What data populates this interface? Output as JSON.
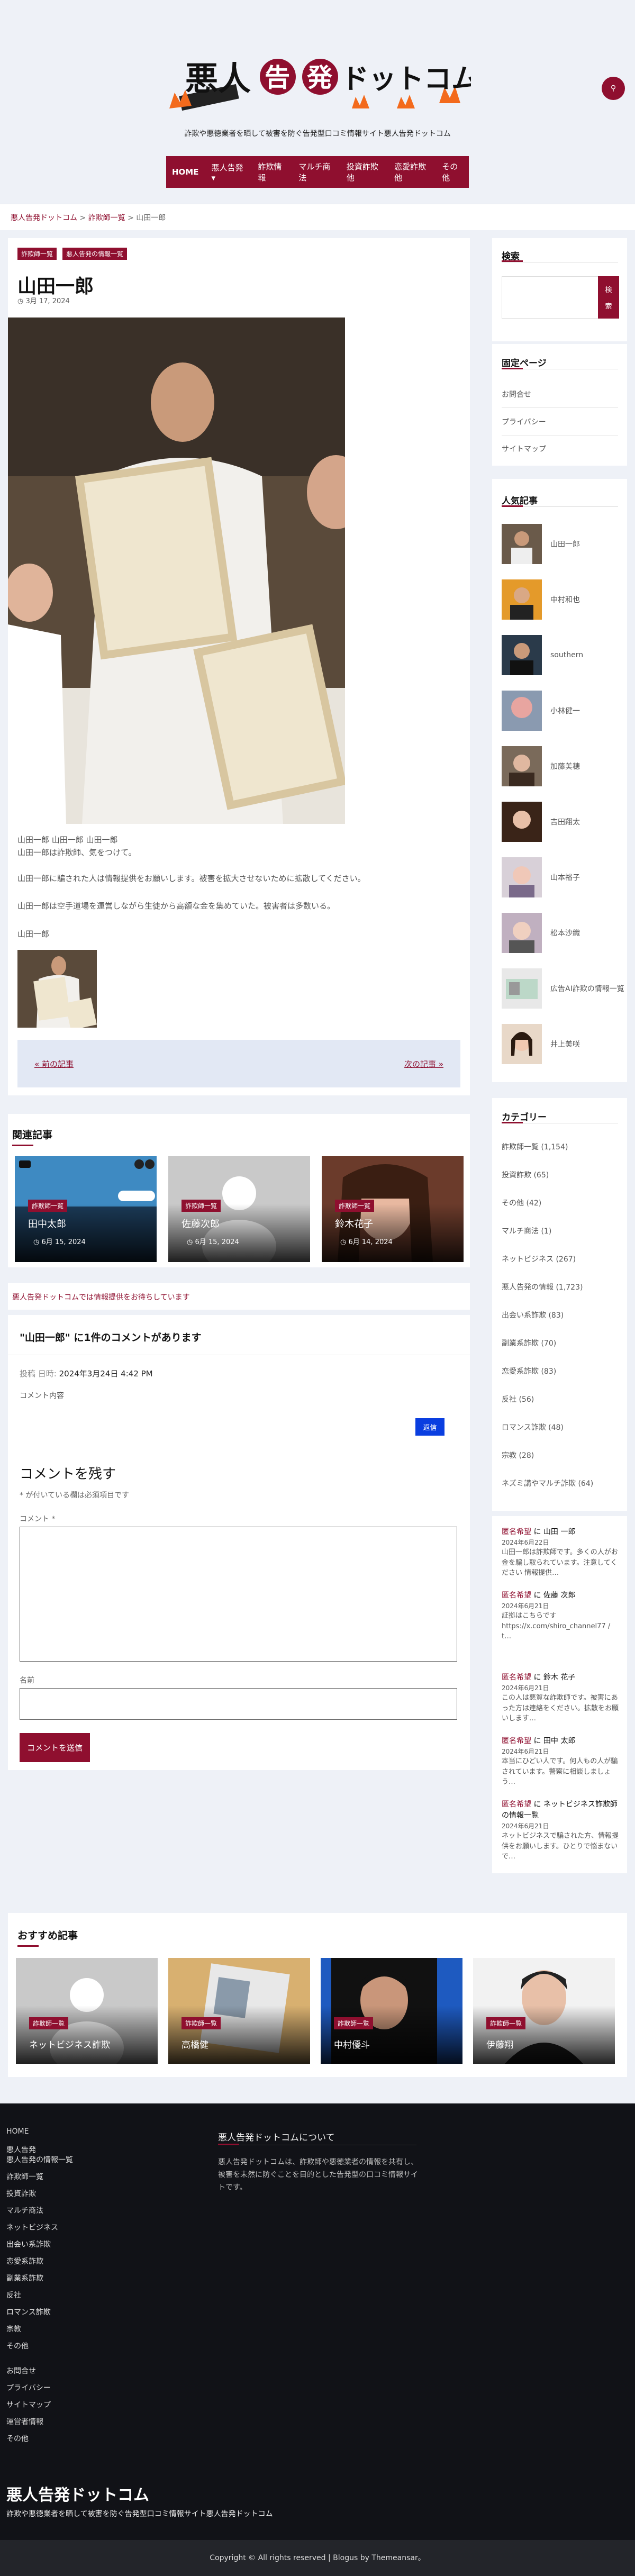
{
  "header": {
    "logo_text": "悪人告発ドットコム",
    "tagline": "詐欺や悪徳業者を晒して被害を防ぐ告発型口コミ情報サイト悪人告発ドットコム",
    "search_icon": "search-icon"
  },
  "nav": {
    "items": [
      "HOME",
      "悪人告発 ▾",
      "詐欺情報",
      "マルチ商法",
      "投資詐欺他",
      "恋愛詐欺他",
      "その他"
    ]
  },
  "breadcrumb": {
    "home": "悪人告発ドットコム",
    "category": "詐欺師一覧",
    "sep": ">",
    "current": "山田一郎"
  },
  "post": {
    "badges": [
      "詐欺師一覧",
      "悪人告発の情報一覧"
    ],
    "title": "山田一郎",
    "date": "3月 17, 2024",
    "para1": "山田一郎 山田一郎 山田一郎",
    "para1b": "山田一郎は詐欺師、気をつけて。",
    "para2": "山田一郎に騙された人は情報提供をお願いします。被害を拡大させないために拡散してください。",
    "para3": "山田一郎は空手道場を運営しながら生徒から高額な金を集めていた。被害者は多数いる。",
    "para4": "山田一郎",
    "prev": "« 前の記事",
    "next": "次の記事 »"
  },
  "related": {
    "title": "関連記事",
    "items": [
      {
        "badge": "詐欺師一覧",
        "title": "田中太郎",
        "date": "6月 15, 2024"
      },
      {
        "badge": "詐欺師一覧",
        "title": "佐藤次郎",
        "date": "6月 15, 2024"
      },
      {
        "badge": "詐欺師一覧",
        "title": "鈴木花子",
        "date": "6月 14, 2024"
      }
    ]
  },
  "share": {
    "text": "悪人告発ドットコムでは情報提供をお待ちしています"
  },
  "comments": {
    "title": "\"山田一郎\" に1件のコメントがあります",
    "meta_label": "投稿 日時:",
    "meta_date": "2024年3月24日 4:42 PM",
    "body": "コメント内容",
    "reply_label": "返信",
    "reply_title": "コメントを残す",
    "reply_note": "* が付いている欄は必須項目です",
    "comment_label": "コメント *",
    "name_label": "名前",
    "submit": "コメントを送信"
  },
  "sidebar": {
    "search_title": "検索",
    "search_placeholder": "",
    "search_btn_top": "検",
    "search_btn_bottom": "索",
    "fixed_title": "固定ページ",
    "fixed_pages": [
      "お問合せ",
      "プライバシー",
      "サイトマップ"
    ],
    "popular_title": "人気記事",
    "popular": [
      "山田一郎",
      "中村和也",
      "southern",
      "小林健一",
      "加藤美穂",
      "吉田翔太",
      "山本裕子",
      "松本沙織",
      "広告AI詐欺の情報一覧",
      "井上美咲"
    ],
    "categories_title": "カテゴリー",
    "categories": [
      "詐欺師一覧 (1,154)",
      "投資詐欺 (65)",
      "その他 (42)",
      "マルチ商法 (1)",
      "ネットビジネス (267)",
      "悪人告発の情報 (1,723)",
      "出会い系詐欺 (83)",
      "副業系詐欺 (70)",
      "恋愛系詐欺 (83)",
      "反社 (56)",
      "ロマンス詐欺 (48)",
      "宗教 (28)",
      "ネズミ講やマルチ詐欺 (64)"
    ],
    "recent_comments": [
      {
        "name": "匿名希望",
        "on": "に 山田 一郎",
        "date": "2024年6月22日",
        "text": "山田一郎は詐欺師です。多くの人がお金を騙し取られています。注意してください 情報提供…"
      },
      {
        "name": "匿名希望",
        "on": "に 佐藤 次郎",
        "date": "2024年6月21日",
        "text": "証拠はこちらです https://x.com/shiro_channel77 / t…"
      },
      {
        "name": "匿名希望",
        "on": "に 鈴木 花子",
        "date": "2024年6月21日",
        "text": "この人は悪質な詐欺師です。被害にあった方は連絡をください。拡散をお願いします…"
      },
      {
        "name": "匿名希望",
        "on": "に 田中 太郎",
        "date": "2024年6月21日",
        "text": "本当にひどい人です。何人もの人が騙されています。警察に相談しましょう…"
      },
      {
        "name": "匿名希望",
        "on": "に ネットビジネス詐欺師の情報一覧",
        "date": "2024年6月21日",
        "text": "ネットビジネスで騙された方、情報提供をお願いします。ひとりで悩まないで…"
      }
    ]
  },
  "recommend": {
    "title": "おすすめ記事",
    "items": [
      {
        "badge": "詐欺師一覧",
        "title": "ネットビジネス詐欺"
      },
      {
        "badge": "詐欺師一覧",
        "title": "高橋健"
      },
      {
        "badge": "詐欺師一覧",
        "title": "中村優斗"
      },
      {
        "badge": "詐欺師一覧",
        "title": "伊藤翔"
      }
    ]
  },
  "footer": {
    "nav_col1": [
      "HOME",
      "悪人告発",
      "悪人告発の情報一覧",
      "詐欺師一覧",
      "投資詐欺",
      "マルチ商法",
      "ネットビジネス",
      "出会い系詐欺",
      "恋愛系詐欺",
      "副業系詐欺",
      "反社",
      "ロマンス詐欺",
      "宗教",
      "その他"
    ],
    "nav_col2": [
      "お問合せ",
      "プライバシー",
      "サイトマップ",
      "運営者情報",
      "その他"
    ],
    "desc_title": "悪人告発ドットコムについて",
    "desc": "悪人告発ドットコムは、詐欺師や悪徳業者の情報を共有し、被害を未然に防ぐことを目的とした告発型の口コミ情報サイトです。",
    "brand": "悪人告発ドットコム",
    "brand_desc": "詐欺や悪徳業者を晒して被害を防ぐ告発型口コミ情報サイト悪人告発ドットコム",
    "copyright": "Copyright © All rights reserved | Blogus by Themeansar。"
  },
  "colors": {
    "accent": "#8f0f2f",
    "reply": "#0a3ee0",
    "footer_bg": "#111217"
  }
}
